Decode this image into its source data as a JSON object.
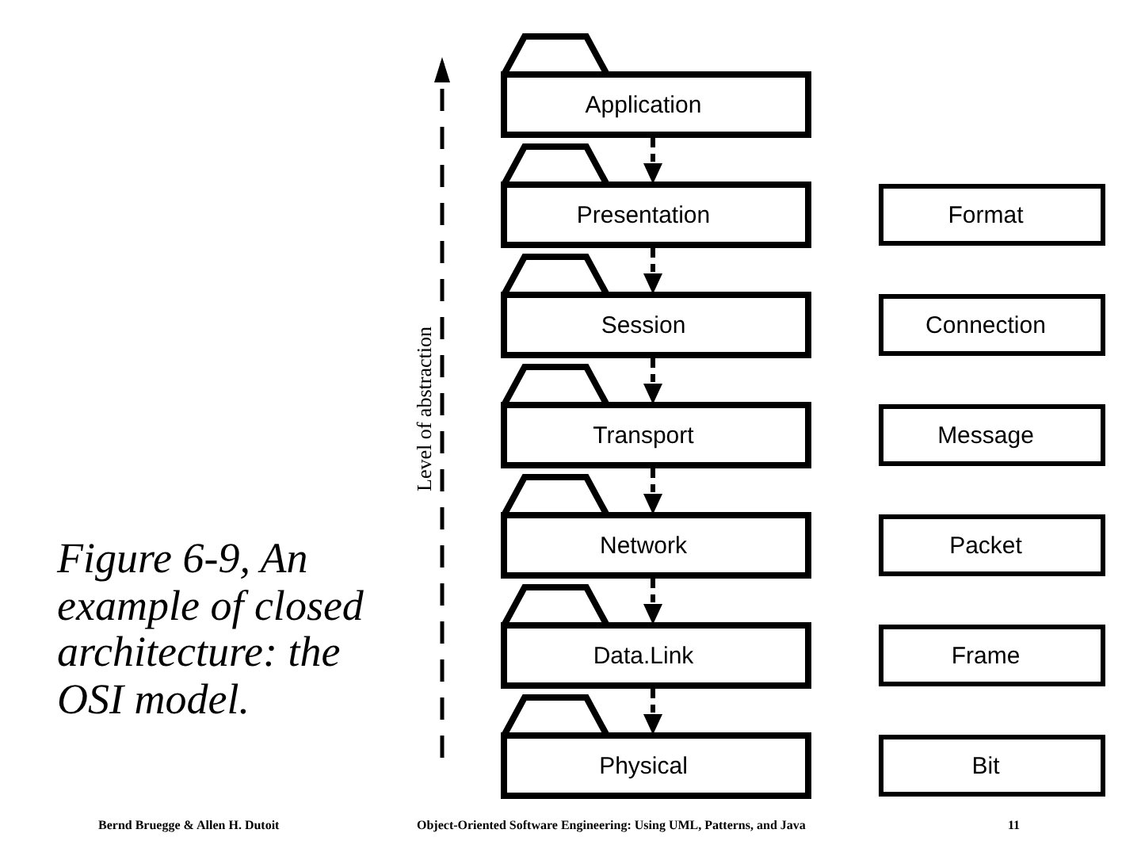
{
  "diagram": {
    "axis_label": "Level of abstraction",
    "layers": [
      {
        "name": "Application"
      },
      {
        "name": "Presentation",
        "service": "Format"
      },
      {
        "name": "Session",
        "service": "Connection"
      },
      {
        "name": "Transport",
        "service": "Message"
      },
      {
        "name": "Network",
        "service": "Packet"
      },
      {
        "name": "Data.Link",
        "service": "Frame"
      },
      {
        "name": "Physical",
        "service": "Bit"
      }
    ]
  },
  "caption": "Figure 6-9, An example of closed architecture: the OSI model.",
  "footer": {
    "authors": "Bernd Bruegge & Allen H. Dutoit",
    "book": "Object-Oriented Software Engineering: Using UML, Patterns, and Java",
    "page": "11"
  }
}
